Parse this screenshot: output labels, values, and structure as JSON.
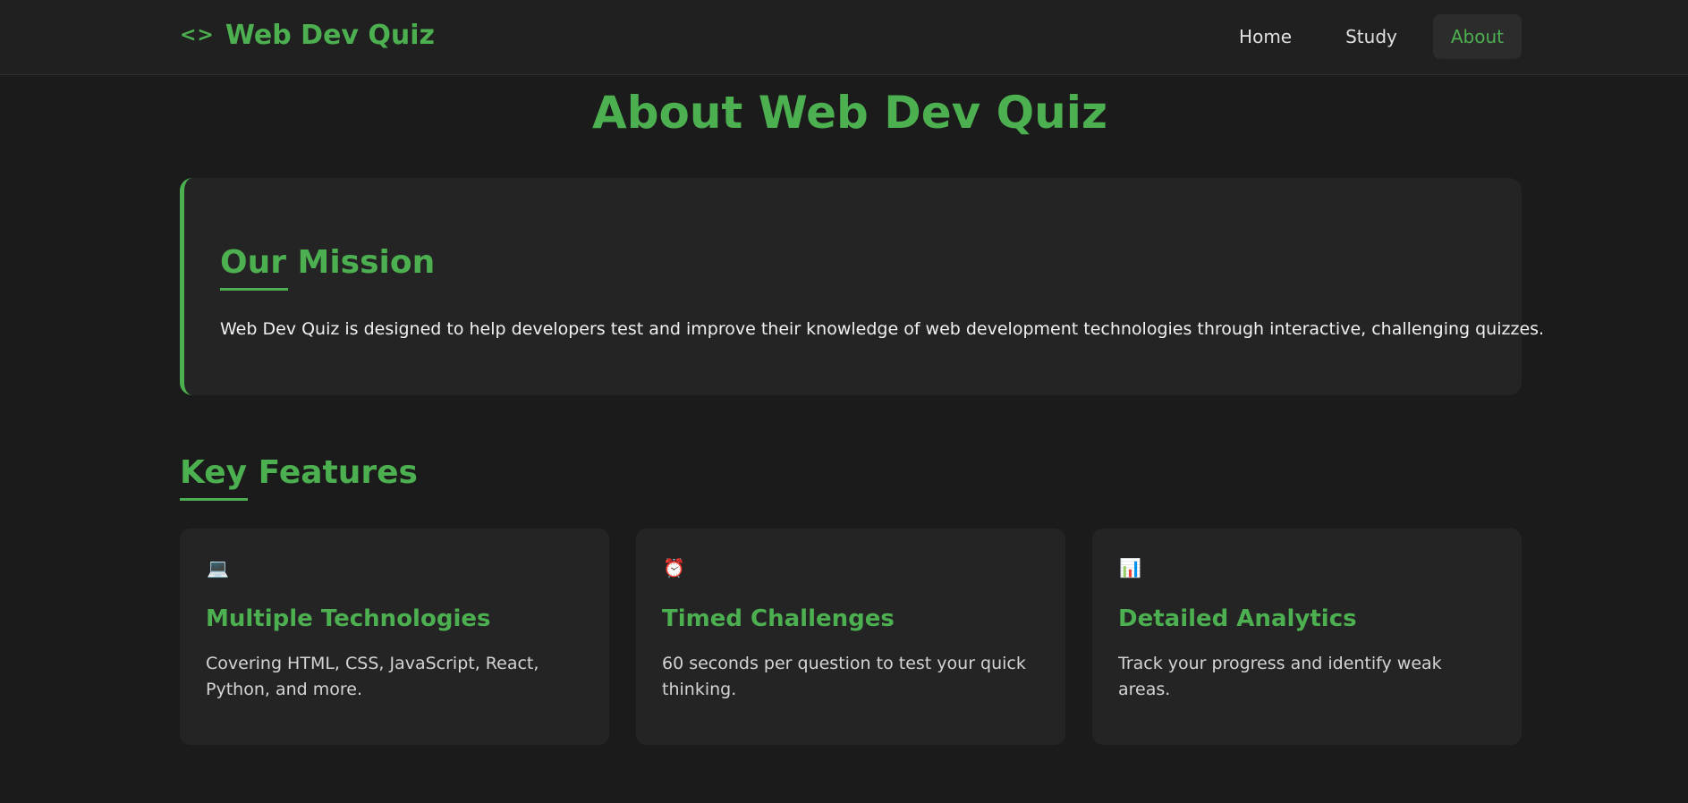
{
  "nav": {
    "brand_icon": "<>",
    "brand_title": "Web Dev Quiz",
    "links": [
      {
        "label": "Home",
        "active": false
      },
      {
        "label": "Study",
        "active": false
      },
      {
        "label": "About",
        "active": true
      }
    ]
  },
  "page": {
    "title": "About Web Dev Quiz"
  },
  "mission": {
    "heading": "Our Mission",
    "text": "Web Dev Quiz is designed to help developers test and improve their knowledge of web development technologies through interactive, challenging quizzes."
  },
  "features": {
    "heading": "Key Features",
    "items": [
      {
        "icon": "💻",
        "icon_name": "laptop-icon",
        "title": "Multiple Technologies",
        "description": "Covering HTML, CSS, JavaScript, React, Python, and more."
      },
      {
        "icon": "⏰",
        "icon_name": "alarm-clock-icon",
        "title": "Timed Challenges",
        "description": "60 seconds per question to test your quick thinking."
      },
      {
        "icon": "📊",
        "icon_name": "bar-chart-icon",
        "title": "Detailed Analytics",
        "description": "Track your progress and identify weak areas."
      }
    ]
  },
  "colors": {
    "accent": "#4caf50",
    "background": "#1b1b1b",
    "card": "#242424"
  }
}
